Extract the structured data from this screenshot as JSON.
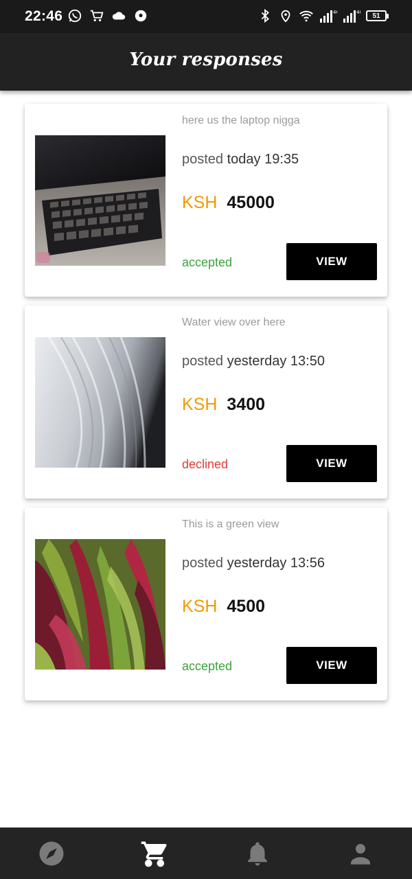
{
  "status_bar": {
    "time": "22:46",
    "left_icons": [
      "whatsapp-icon",
      "cart-icon",
      "cloud-icon",
      "soccer-ball-icon"
    ],
    "right_icons": [
      "bluetooth-icon",
      "location-icon",
      "wifi-icon",
      "signal-icon",
      "signal-icon"
    ],
    "network_label_1": "4G",
    "network_label_2": "4G",
    "battery": "51"
  },
  "header": {
    "title": "Your responses"
  },
  "responses": [
    {
      "image": "laptop-keyboard-photo",
      "description": "here us the laptop nigga",
      "posted_label": "posted",
      "posted_when": "today 19:35",
      "currency": "KSH",
      "amount": "45000",
      "status": "accepted",
      "button_label": "VIEW"
    },
    {
      "image": "waterfall-photo",
      "description": "Water view over here",
      "posted_label": "posted",
      "posted_when": "yesterday 13:50",
      "currency": "KSH",
      "amount": "3400",
      "status": "declined",
      "button_label": "VIEW"
    },
    {
      "image": "red-green-leaves-photo",
      "description": "This is a green view",
      "posted_label": "posted",
      "posted_when": "yesterday 13:56",
      "currency": "KSH",
      "amount": "4500",
      "status": "accepted",
      "button_label": "VIEW"
    }
  ],
  "bottom_nav": {
    "items": [
      {
        "icon": "compass-icon",
        "active": false
      },
      {
        "icon": "cart-icon",
        "active": true
      },
      {
        "icon": "bell-icon",
        "active": false
      },
      {
        "icon": "person-icon",
        "active": false
      }
    ]
  },
  "colors": {
    "price_currency": "#f39800",
    "status_accepted": "#3aa23a",
    "status_declined": "#e53935",
    "app_bar": "#222222",
    "nav_active": "#ffffff",
    "nav_inactive": "#7a7a7a"
  }
}
